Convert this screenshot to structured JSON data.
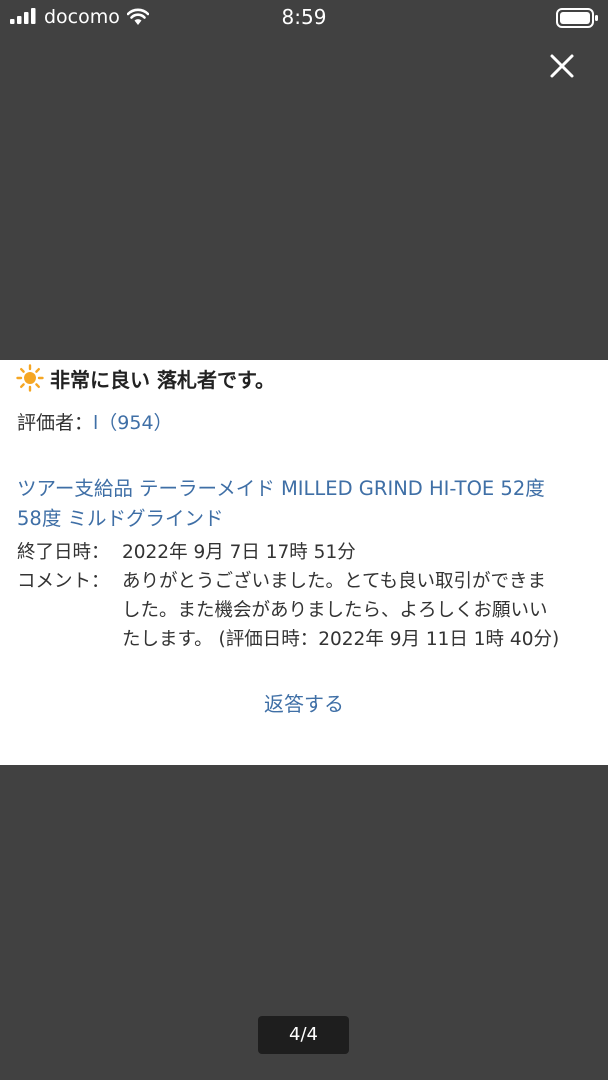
{
  "status_bar": {
    "carrier": "docomo",
    "time": "8:59"
  },
  "feedback": {
    "rating_label": "非常に良い 落札者です。",
    "evaluator_label": "評価者：",
    "evaluator_name": "l",
    "evaluator_score": "（954）",
    "item_title_line1": "ツアー支給品 テーラーメイド MILLED GRIND HI-TOE 52度",
    "item_title_line2": "58度 ミルドグラインド",
    "end_date_label": "終了日時：",
    "end_date_value": "2022年 9月 7日 17時 51分",
    "comment_label": "コメント：",
    "comment_line1": "ありがとうございました。とても良い取引ができま",
    "comment_line2": "した。また機会がありましたら、よろしくお願いい",
    "comment_line3": "たします。 (評価日時：2022年 9月 11日 1時 40分)",
    "reply_label": "返答する"
  },
  "pager": {
    "label": "4/4"
  },
  "colors": {
    "backdrop": "#414141",
    "link": "#3f6fa6",
    "sun": "#f5a623"
  },
  "icons": [
    "signal-icon",
    "wifi-icon",
    "battery-icon",
    "close-icon",
    "sun-icon"
  ]
}
